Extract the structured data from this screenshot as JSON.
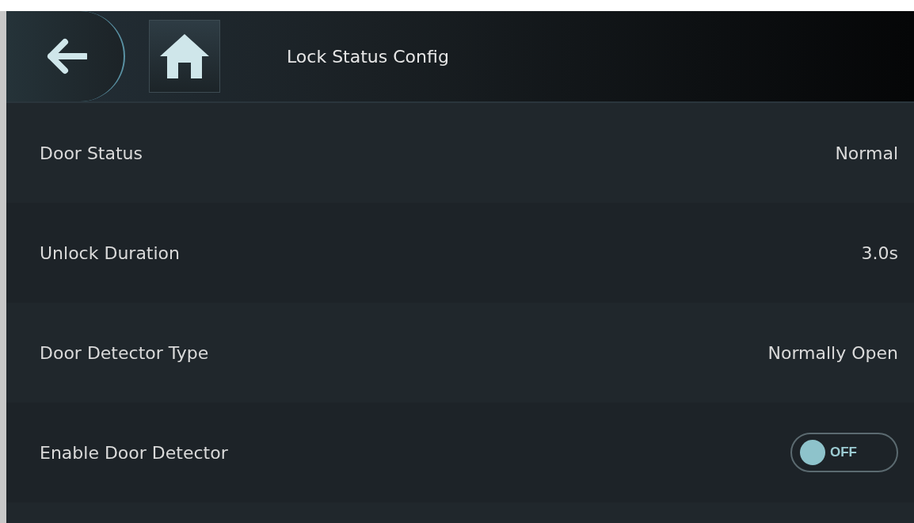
{
  "header": {
    "title": "Lock Status Config"
  },
  "rows": [
    {
      "kind": "value",
      "label": "Door Status",
      "value": "Normal"
    },
    {
      "kind": "value",
      "label": "Unlock Duration",
      "value": "3.0s"
    },
    {
      "kind": "value",
      "label": "Door Detector Type",
      "value": "Normally Open"
    },
    {
      "kind": "toggle",
      "label": "Enable Door Detector",
      "on": false,
      "toggle_text": "OFF"
    }
  ]
}
